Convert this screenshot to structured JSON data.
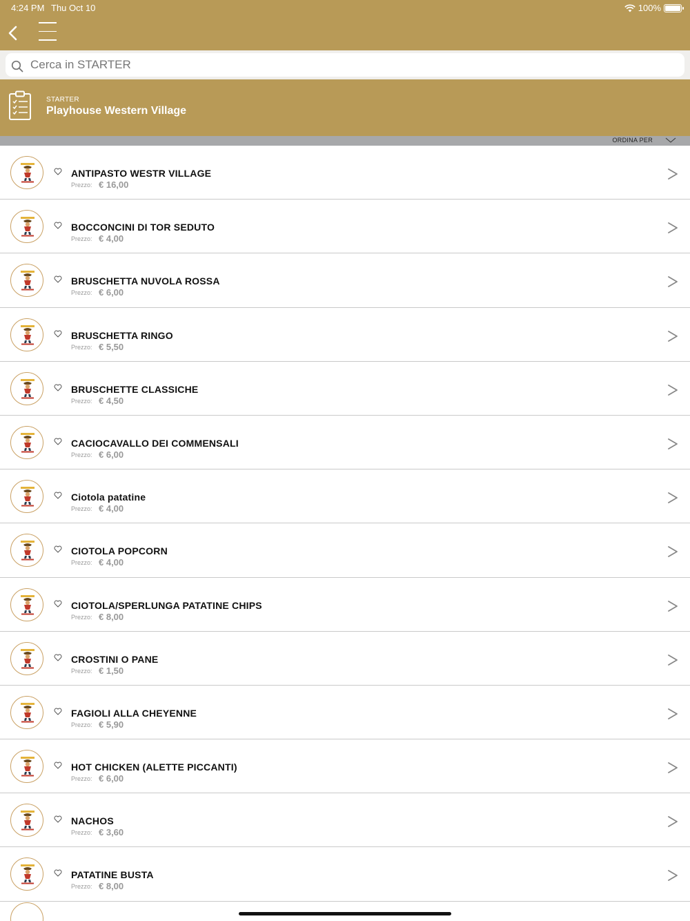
{
  "status": {
    "time": "4:24 PM",
    "date": "Thu Oct 10",
    "battery": "100%"
  },
  "nav": {
    "back_icon": "chevron-left-icon",
    "menu_icon": "hamburger-icon"
  },
  "search": {
    "placeholder": "Cerca in STARTER",
    "value": ""
  },
  "category": {
    "label": "STARTER",
    "title": "Playhouse Western Village"
  },
  "sort": {
    "label": "ORDINA PER"
  },
  "colors": {
    "accent": "#b89a57",
    "sortbar": "#a7a8aa"
  },
  "items": [
    {
      "name": "ANTIPASTO WESTR VILLAGE",
      "price_label": "Prezzo:",
      "price": "€ 16,00"
    },
    {
      "name": "BOCCONCINI DI TOR SEDUTO",
      "price_label": "Prezzo:",
      "price": "€ 4,00"
    },
    {
      "name": "BRUSCHETTA NUVOLA ROSSA",
      "price_label": "Prezzo:",
      "price": "€ 6,00"
    },
    {
      "name": "BRUSCHETTA RINGO",
      "price_label": "Prezzo:",
      "price": "€ 5,50"
    },
    {
      "name": "BRUSCHETTE CLASSICHE",
      "price_label": "Prezzo:",
      "price": "€ 4,50"
    },
    {
      "name": "CACIOCAVALLO DEI COMMENSALI",
      "price_label": "Prezzo:",
      "price": "€ 6,00"
    },
    {
      "name": "Ciotola patatine",
      "price_label": "Prezzo:",
      "price": "€ 4,00"
    },
    {
      "name": "CIOTOLA POPCORN",
      "price_label": "Prezzo:",
      "price": "€ 4,00"
    },
    {
      "name": "CIOTOLA/SPERLUNGA PATATINE CHIPS",
      "price_label": "Prezzo:",
      "price": "€ 8,00"
    },
    {
      "name": "CROSTINI O PANE",
      "price_label": "Prezzo:",
      "price": "€ 1,50"
    },
    {
      "name": "FAGIOLI ALLA CHEYENNE",
      "price_label": "Prezzo:",
      "price": "€ 5,90"
    },
    {
      "name": "HOT CHICKEN (ALETTE PICCANTI)",
      "price_label": "Prezzo:",
      "price": "€ 6,00"
    },
    {
      "name": "NACHOS",
      "price_label": "Prezzo:",
      "price": "€ 3,60"
    },
    {
      "name": "PATATINE BUSTA",
      "price_label": "Prezzo:",
      "price": "€ 8,00"
    }
  ]
}
